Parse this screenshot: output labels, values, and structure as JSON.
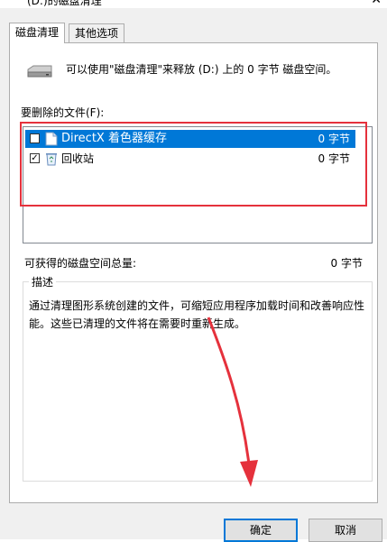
{
  "window": {
    "title": "(D:)的磁盘清理",
    "close_glyph": "✕"
  },
  "tabs": [
    {
      "label": "磁盘清理",
      "active": true
    },
    {
      "label": "其他选项",
      "active": false
    }
  ],
  "summary_text": "可以使用\"磁盘清理\"来释放 (D:) 上的 0 字节 磁盘空间。",
  "files_to_delete_label": "要删除的文件(F):",
  "files": [
    {
      "name": "DirectX 着色器缓存",
      "size": "0 字节",
      "checked": false,
      "selected": true,
      "icon": "file-icon"
    },
    {
      "name": "回收站",
      "size": "0 字节",
      "checked": true,
      "selected": false,
      "icon": "recycle-bin-icon"
    }
  ],
  "space_gained_label": "可获得的磁盘空间总量:",
  "space_gained_value": "0 字节",
  "description": {
    "title": "描述",
    "text": "通过清理图形系统创建的文件，可缩短应用程序加载时间和改善响应性能。这些已清理的文件将在需要时重新生成。"
  },
  "buttons": {
    "ok": "确定",
    "cancel": "取消"
  },
  "colors": {
    "selection": "#0078d7",
    "annotation_red": "#e5313c"
  }
}
